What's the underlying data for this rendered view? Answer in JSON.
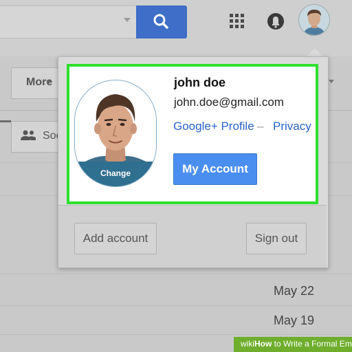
{
  "header": {
    "apps_icon": "grid-icon",
    "notifications_icon": "bell-icon",
    "search_icon": "search-icon"
  },
  "toolbar": {
    "more_label": "More",
    "social_tab_label": "Soc"
  },
  "account_popup": {
    "name": "john doe",
    "email": "john.doe@gmail.com",
    "profile_link": "Google+ Profile",
    "separator": "–",
    "privacy_link": "Privacy",
    "my_account_button": "My Account",
    "change_photo_label": "Change",
    "add_account_button": "Add account",
    "sign_out_button": "Sign out",
    "highlight_color": "#2ee02e"
  },
  "mail_list": {
    "dates": [
      "May 22",
      "May 19"
    ]
  },
  "watermark": {
    "brand": "wiki",
    "text_bold": "How",
    "text": " to Write a Formal Email"
  },
  "colors": {
    "accent_blue": "#4a8ef0",
    "link_blue": "#2a62c9"
  }
}
